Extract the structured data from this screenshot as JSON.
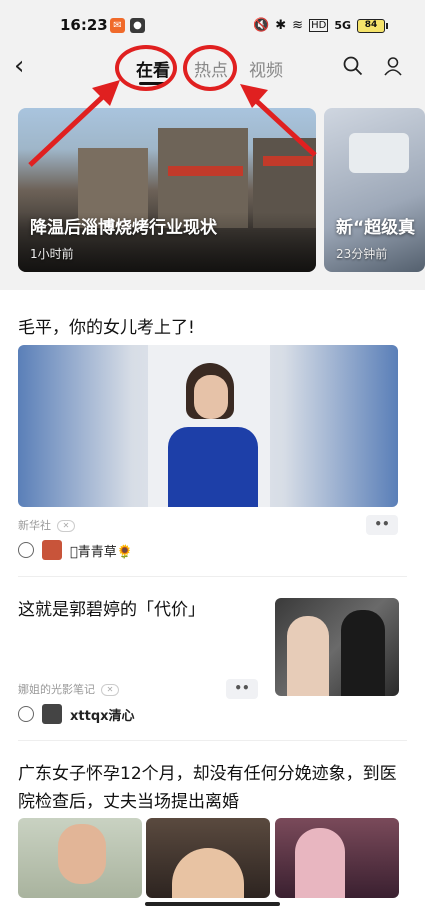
{
  "status": {
    "time": "16:23",
    "battery": "84",
    "signal": "5G"
  },
  "nav": {
    "tabs": [
      {
        "label": "在看",
        "active": true
      },
      {
        "label": "热点",
        "active": false
      },
      {
        "label": "视频",
        "active": false
      }
    ]
  },
  "hero": [
    {
      "title": "降温后淄博烧烤行业现状",
      "time": "1小时前"
    },
    {
      "title": "新“超级真",
      "time": "23分钟前"
    }
  ],
  "feed": [
    {
      "title": "毛平，你的女儿考上了!",
      "source": "新华社",
      "user": "\u0000青青草🌻"
    },
    {
      "title": "这就是郭碧婷的「代价」",
      "source": "娜姐的光影笔记",
      "user": "xttqx清心"
    },
    {
      "title": "广东女子怀孕12个月，却没有任何分娩迹象，到医院检查后，丈夫当场提出离婚"
    }
  ],
  "colors": {
    "accent": "#e02020",
    "bg": "#f2f2f2"
  }
}
